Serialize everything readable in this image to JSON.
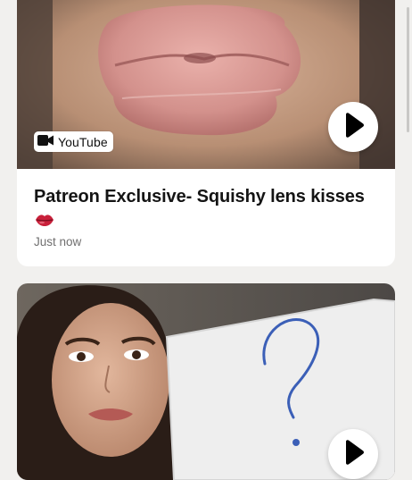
{
  "posts": [
    {
      "badge": {
        "label": "YouTube",
        "icon": "video-camera-icon"
      },
      "title": "Patreon Exclusive- Squishy lens kisses",
      "emoji": "lips-emoji-icon",
      "timestamp": "Just now",
      "play_icon": "play-icon"
    },
    {
      "play_icon": "play-icon",
      "whiteboard_drawing": "question-mark"
    }
  ],
  "colors": {
    "background": "#f1f0ee",
    "card": "#ffffff",
    "title_text": "#141414",
    "meta_text": "#706f6f",
    "emoji_lips": "#c8203a"
  }
}
